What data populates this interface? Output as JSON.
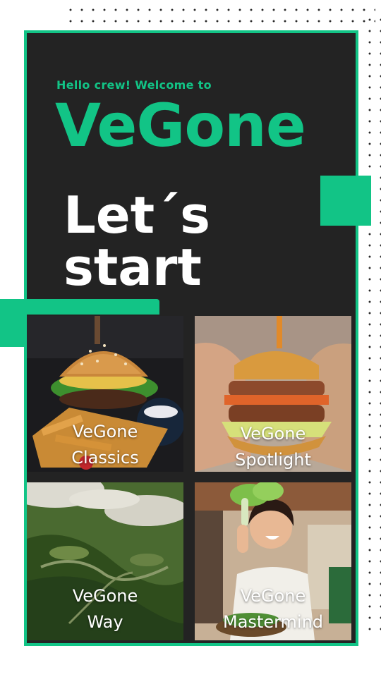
{
  "header": {
    "greeting": "Hello crew! Welcome to",
    "brand": "VeGone",
    "headline_line1": "Let´s",
    "headline_line2": "start"
  },
  "tiles": [
    {
      "line1": "VeGone",
      "line2": "Classics",
      "image": "burger-with-fries-image"
    },
    {
      "line1": "VeGone",
      "line2": "Spotlight",
      "image": "hands-holding-burger-image"
    },
    {
      "line1": "VeGone",
      "line2": "Way",
      "image": "aerial-forest-image"
    },
    {
      "line1": "VeGone",
      "line2": "Mastermind",
      "image": "woman-with-leafy-greens-image"
    }
  ],
  "colors": {
    "accent": "#12c486",
    "panel": "#232323",
    "background": "#ffffff",
    "text": "#ffffff"
  }
}
